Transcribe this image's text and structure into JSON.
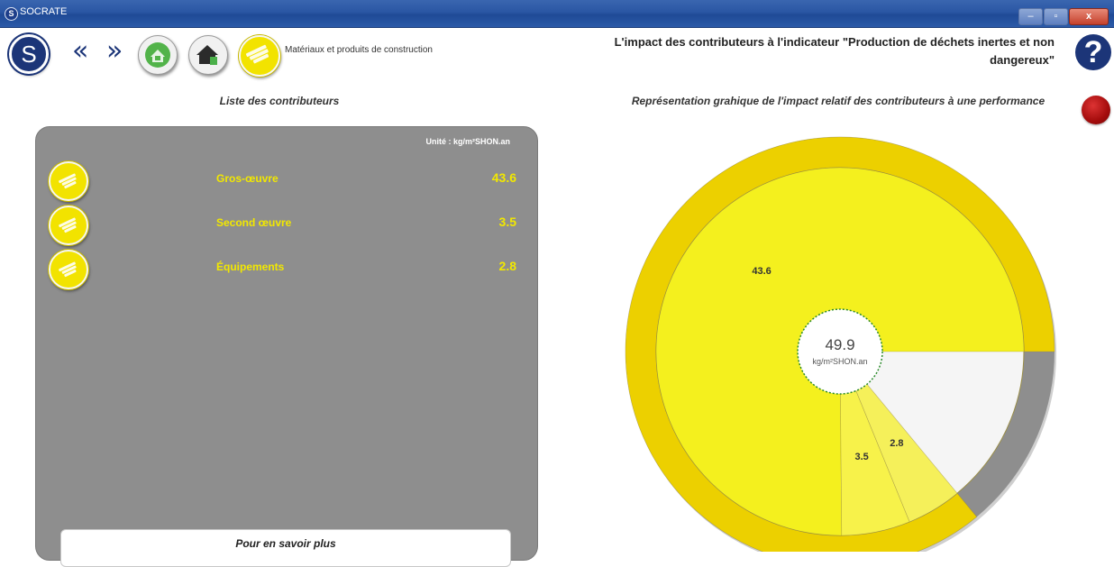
{
  "window": {
    "title": "SOCRATE",
    "app_icon": "S",
    "controls": [
      "minimize",
      "maximize",
      "close"
    ]
  },
  "toolbar": {
    "logo": "S",
    "back_icon": "«",
    "forward_icon": "»",
    "buttons": [
      {
        "name": "globe-house-icon"
      },
      {
        "name": "house-icon"
      },
      {
        "name": "bricks-icon"
      }
    ],
    "breadcrumb": "Matériaux et produits de construction",
    "help": "?"
  },
  "header": {
    "title": "L'impact des contributeurs à l'indicateur \"Production de déchets inertes et non dangereux\""
  },
  "left": {
    "section_title": "Liste des contributeurs",
    "unit": "Unité : kg/m²SHON.an",
    "rows": [
      {
        "label": "Gros-œuvre",
        "value": "43.6"
      },
      {
        "label": "Second œuvre",
        "value": "3.5"
      },
      {
        "label": "Équipements",
        "value": "2.8"
      }
    ],
    "more_button": "Pour en savoir plus"
  },
  "right": {
    "section_title": "Représentation grahique de l'impact relatif des contributeurs à une performance"
  },
  "chart_data": {
    "type": "pie",
    "center_value": "49.9",
    "center_unit": "kg/m²SHON.an",
    "slices": [
      {
        "label": "43.6",
        "value": 43.6,
        "color": "#f4f01e"
      },
      {
        "label": "3.5",
        "value": 3.5,
        "color": "#f7f24a"
      },
      {
        "label": "2.8",
        "value": 2.8,
        "color": "#f5f05a"
      }
    ],
    "colors": {
      "ring": "#ecd000",
      "remainder": "#f5f5f5",
      "ring_remainder": "#8e8e8e",
      "center_border": "#2a8a2a"
    }
  }
}
